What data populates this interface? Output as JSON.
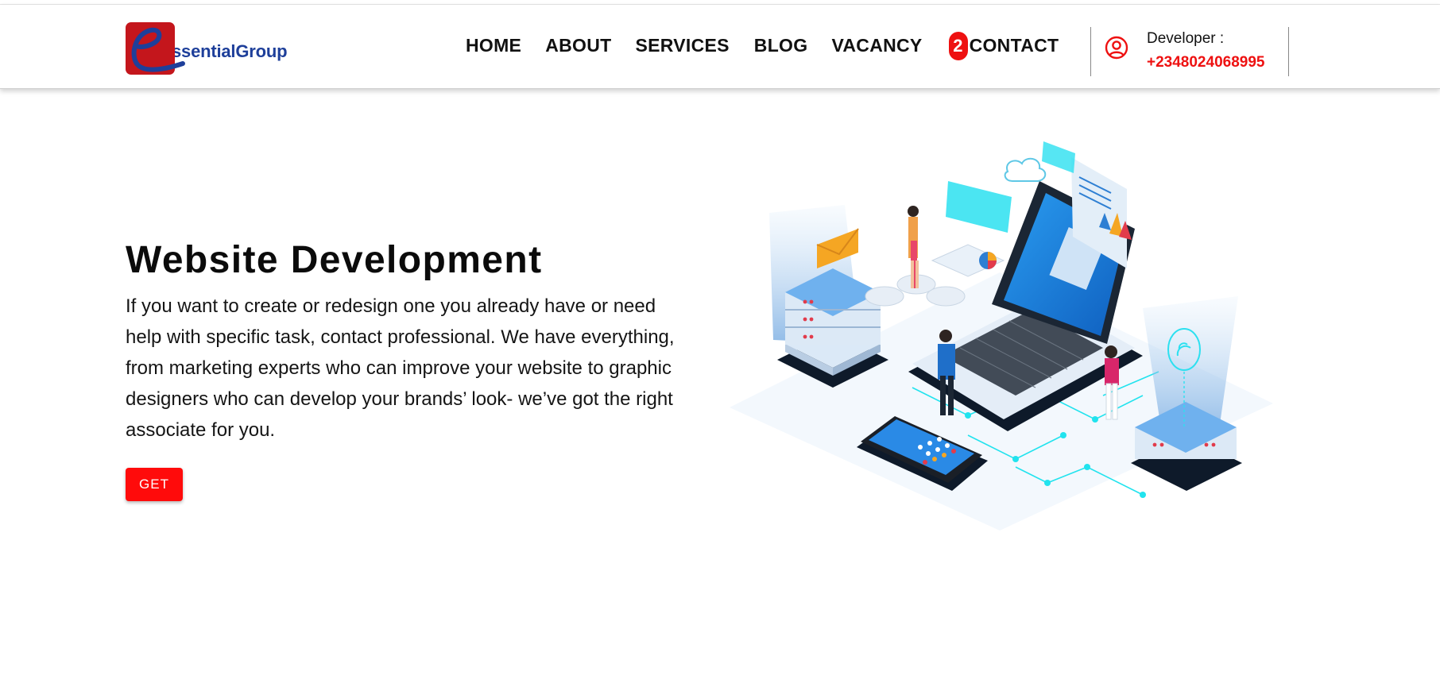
{
  "brand": {
    "logo_letter": "e",
    "name": "ssentialGroup",
    "colors": {
      "logo_bg": "#c4161c",
      "logo_text": "#1e3f9a"
    }
  },
  "nav": {
    "items": [
      {
        "label": "HOME"
      },
      {
        "label": "ABOUT"
      },
      {
        "label": "SERVICES"
      },
      {
        "label": "BLOG"
      },
      {
        "label": "VACANCY",
        "badge": "2"
      },
      {
        "label": "CONTACT"
      }
    ]
  },
  "developer": {
    "label": "Developer :",
    "phone": "+2348024068995",
    "icon": "user-circle-icon"
  },
  "hero": {
    "title": "Website Development",
    "text": "If you want to create or redesign one you already have or need help with specific task, contact professional. We have everything, from marketing experts who can improve your website to graphic designers who can develop your brands’ look- we’ve got the right associate for you.",
    "button": "GET",
    "illustration": "isometric-web-development-illustration"
  },
  "colors": {
    "accent": "#ee1111",
    "button": "#ff0b0b"
  }
}
